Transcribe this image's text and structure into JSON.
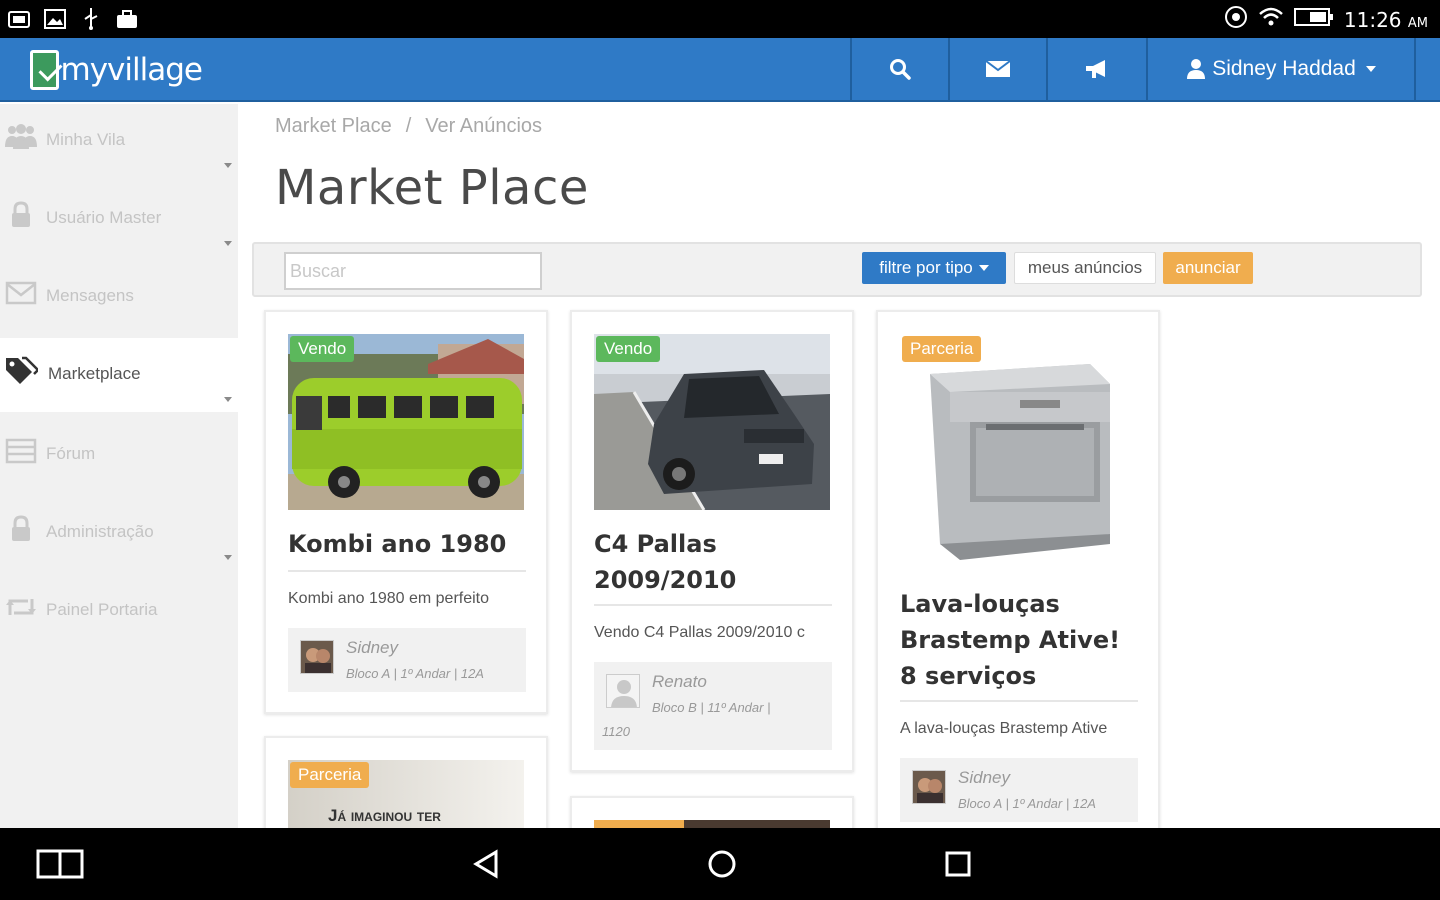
{
  "status_bar": {
    "time": "11:26",
    "ampm": "AM",
    "left_icons": [
      "photo-icon",
      "image-icon",
      "usb-icon",
      "briefcase-icon"
    ],
    "right_icons": [
      "sync-icon",
      "wifi-icon",
      "battery-icon"
    ]
  },
  "header": {
    "logo_text": "myvillage",
    "user_name": "Sidney Haddad",
    "brand_color": "#2f7ac6"
  },
  "sidebar": {
    "items": [
      {
        "label": "Minha Vila",
        "icon": "users-icon",
        "has_submenu": true,
        "active": false
      },
      {
        "label": "Usuário Master",
        "icon": "lock-icon",
        "has_submenu": true,
        "active": false
      },
      {
        "label": "Mensagens",
        "icon": "envelope-icon",
        "has_submenu": false,
        "active": false
      },
      {
        "label": "Marketplace",
        "icon": "tags-icon",
        "has_submenu": true,
        "active": true
      },
      {
        "label": "Fórum",
        "icon": "forum-icon",
        "has_submenu": false,
        "active": false
      },
      {
        "label": "Administração",
        "icon": "lock-icon",
        "has_submenu": true,
        "active": false
      },
      {
        "label": "Painel Portaria",
        "icon": "retweet-icon",
        "has_submenu": false,
        "active": false
      }
    ]
  },
  "breadcrumb": {
    "items": [
      "Market Place",
      "Ver Anúncios"
    ],
    "separator": "/"
  },
  "page_title": "Market Place",
  "toolbar": {
    "search_placeholder": "Buscar",
    "filter_label": "filtre por tipo",
    "my_ads_label": "meus anúncios",
    "post_label": "anunciar"
  },
  "listings": [
    {
      "tag": "Vendo",
      "title": "Kombi ano 1980",
      "description": "Kombi ano 1980 em perfeito",
      "user": "Sidney",
      "location": "Bloco A | 1º Andar | 12A"
    },
    {
      "tag": "Vendo",
      "title": "C4 Pallas 2009/2010",
      "description": "Vendo C4 Pallas 2009/2010 c",
      "user": "Renato",
      "location": "Bloco B | 11º Andar |",
      "location_extra": "1120"
    },
    {
      "tag": "Parceria",
      "title": "Lava-louças Brastemp Ative! 8 serviços",
      "description": "A lava-louças Brastemp Ative",
      "user": "Sidney",
      "location": "Bloco A | 1º Andar | 12A"
    },
    {
      "tag": "Parceria",
      "image_caption": "Já imaginou ter"
    }
  ]
}
